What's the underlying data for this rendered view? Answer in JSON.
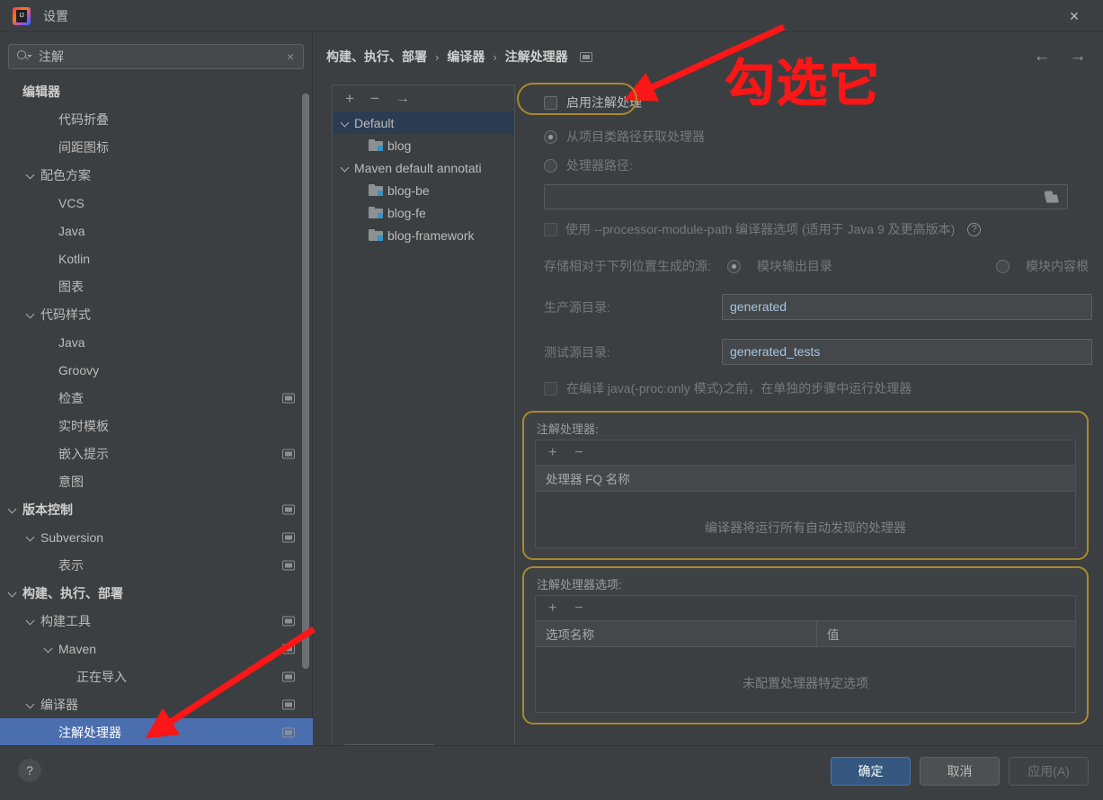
{
  "window": {
    "title": "设置",
    "logo_text": "IJ",
    "close_icon": "×"
  },
  "search": {
    "value": "注解",
    "clear_icon": "×"
  },
  "sidebar": {
    "items": [
      {
        "label": "编辑器",
        "depth": 0,
        "bold": true,
        "chevron": false,
        "badge": false,
        "selected": false
      },
      {
        "label": "代码折叠",
        "depth": 2,
        "bold": false,
        "chevron": false,
        "badge": false,
        "selected": false
      },
      {
        "label": "间距图标",
        "depth": 2,
        "bold": false,
        "chevron": false,
        "badge": false,
        "selected": false
      },
      {
        "label": "配色方案",
        "depth": 1,
        "bold": false,
        "chevron": true,
        "badge": false,
        "selected": false
      },
      {
        "label": "VCS",
        "depth": 2,
        "bold": false,
        "chevron": false,
        "badge": false,
        "selected": false
      },
      {
        "label": "Java",
        "depth": 2,
        "bold": false,
        "chevron": false,
        "badge": false,
        "selected": false
      },
      {
        "label": "Kotlin",
        "depth": 2,
        "bold": false,
        "chevron": false,
        "badge": false,
        "selected": false
      },
      {
        "label": "图表",
        "depth": 2,
        "bold": false,
        "chevron": false,
        "badge": false,
        "selected": false
      },
      {
        "label": "代码样式",
        "depth": 1,
        "bold": false,
        "chevron": true,
        "badge": false,
        "selected": false
      },
      {
        "label": "Java",
        "depth": 2,
        "bold": false,
        "chevron": false,
        "badge": false,
        "selected": false
      },
      {
        "label": "Groovy",
        "depth": 2,
        "bold": false,
        "chevron": false,
        "badge": false,
        "selected": false
      },
      {
        "label": "检查",
        "depth": 2,
        "bold": false,
        "chevron": false,
        "badge": true,
        "selected": false
      },
      {
        "label": "实时模板",
        "depth": 2,
        "bold": false,
        "chevron": false,
        "badge": false,
        "selected": false
      },
      {
        "label": "嵌入提示",
        "depth": 2,
        "bold": false,
        "chevron": false,
        "badge": true,
        "selected": false
      },
      {
        "label": "意图",
        "depth": 2,
        "bold": false,
        "chevron": false,
        "badge": false,
        "selected": false
      },
      {
        "label": "版本控制",
        "depth": 0,
        "bold": true,
        "chevron": true,
        "badge": true,
        "selected": false
      },
      {
        "label": "Subversion",
        "depth": 1,
        "bold": false,
        "chevron": true,
        "badge": true,
        "selected": false
      },
      {
        "label": "表示",
        "depth": 2,
        "bold": false,
        "chevron": false,
        "badge": true,
        "selected": false
      },
      {
        "label": "构建、执行、部署",
        "depth": 0,
        "bold": true,
        "chevron": true,
        "badge": false,
        "selected": false
      },
      {
        "label": "构建工具",
        "depth": 1,
        "bold": false,
        "chevron": true,
        "badge": true,
        "selected": false
      },
      {
        "label": "Maven",
        "depth": 2,
        "bold": false,
        "chevron": true,
        "badge": true,
        "selected": false
      },
      {
        "label": "正在导入",
        "depth": 3,
        "bold": false,
        "chevron": false,
        "badge": true,
        "selected": false
      },
      {
        "label": "编译器",
        "depth": 1,
        "bold": false,
        "chevron": true,
        "badge": true,
        "selected": false
      },
      {
        "label": "注解处理器",
        "depth": 2,
        "bold": false,
        "chevron": false,
        "badge": true,
        "selected": true
      }
    ]
  },
  "breadcrumb": {
    "parts": [
      "构建、执行、部署",
      "编译器",
      "注解处理器"
    ],
    "separator": "›"
  },
  "nav": {
    "back_icon": "←",
    "forward_icon": "→"
  },
  "module_panel": {
    "toolbar": {
      "add": "+",
      "remove": "−",
      "move": "→"
    },
    "items": [
      {
        "label": "Default",
        "type": "group",
        "chevron": true,
        "selected": true
      },
      {
        "label": "blog",
        "type": "module",
        "chevron": false,
        "selected": false
      },
      {
        "label": "Maven default annotati",
        "type": "group",
        "chevron": true,
        "selected": false
      },
      {
        "label": "blog-be",
        "type": "module",
        "chevron": false,
        "selected": false
      },
      {
        "label": "blog-fe",
        "type": "module",
        "chevron": false,
        "selected": false
      },
      {
        "label": "blog-framework",
        "type": "module",
        "chevron": false,
        "selected": false
      }
    ]
  },
  "form": {
    "enable_annotation_processing": "启用注解处理",
    "enable_checked": false,
    "obtain_from_classpath": "从项目类路径获取处理器",
    "processor_path_label": "处理器路径:",
    "processor_path_value": "",
    "use_module_path": "使用 --processor-module-path 编译器选项 (适用于 Java 9 及更高版本)",
    "help_icon": "?",
    "store_generated_label": "存储相对于下列位置生成的源:",
    "store_option_output": "模块输出目录",
    "store_option_content_root": "模块内容根",
    "production_sources_label": "生产源目录:",
    "production_sources_value": "generated",
    "test_sources_label": "测试源目录:",
    "test_sources_value": "generated_tests",
    "proc_only_label": "在编译 java(-proc:only 模式)之前，在单独的步骤中运行处理器"
  },
  "processors_table": {
    "title": "注解处理器:",
    "toolbar": {
      "add": "+",
      "remove": "−"
    },
    "columns": [
      "处理器 FQ 名称"
    ],
    "rows": [],
    "empty_text": "编译器将运行所有自动发现的处理器"
  },
  "options_table": {
    "title": "注解处理器选项:",
    "toolbar": {
      "add": "+",
      "remove": "−"
    },
    "columns": [
      "选项名称",
      "值"
    ],
    "rows": [],
    "empty_text": "未配置处理器特定选项"
  },
  "footer": {
    "help": "?",
    "ok": "确定",
    "cancel": "取消",
    "apply": "应用(A)"
  },
  "annotations": {
    "callout_text": "勾选它",
    "callout_color": "#fb1617",
    "highlight_color": "#a9892f"
  }
}
